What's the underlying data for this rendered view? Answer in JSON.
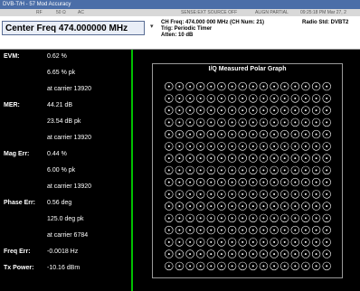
{
  "window_title": "DVB-T/H - 57 Mod Accuracy",
  "header_strip": [
    "RF",
    "50 Ω",
    "AC",
    "SENSE:EXT SOURCE OFF",
    "ALIGN PARTIAL",
    "09:25:18 PM Mar 27, 2"
  ],
  "center_freq_label": "Center Freq 474.000000 MHz",
  "ch_info": [
    "CH Freq: 474.000 000 MHz (CH Num: 21)",
    "Trig: Periodic Timer",
    "Atten: 10 dB"
  ],
  "radio_std": "Radio Std: DVBT2",
  "metrics": [
    {
      "label": "EVM:",
      "value": "0.62  %"
    },
    {
      "label": "",
      "value": "6.65  % pk"
    },
    {
      "label": "",
      "value": "at carrier 13920"
    },
    {
      "label": "MER:",
      "value": "44.21  dB"
    },
    {
      "label": "",
      "value": "23.54  dB pk"
    },
    {
      "label": "",
      "value": "at carrier 13920"
    },
    {
      "label": "Mag Err:",
      "value": "0.44  %"
    },
    {
      "label": "",
      "value": "6.00  % pk"
    },
    {
      "label": "",
      "value": "at carrier 13920"
    },
    {
      "label": "Phase Err:",
      "value": "0.56  deg"
    },
    {
      "label": "",
      "value": "125.0  deg pk"
    },
    {
      "label": "",
      "value": "at carrier 6784"
    },
    {
      "label": "Freq Err:",
      "value": "-0.0018 Hz"
    },
    {
      "label": "Tx Power:",
      "value": "-10.16 dBm"
    }
  ],
  "graph_title": "I/Q Measured Polar Graph",
  "constellation": {
    "rows": 16,
    "cols": 16
  }
}
